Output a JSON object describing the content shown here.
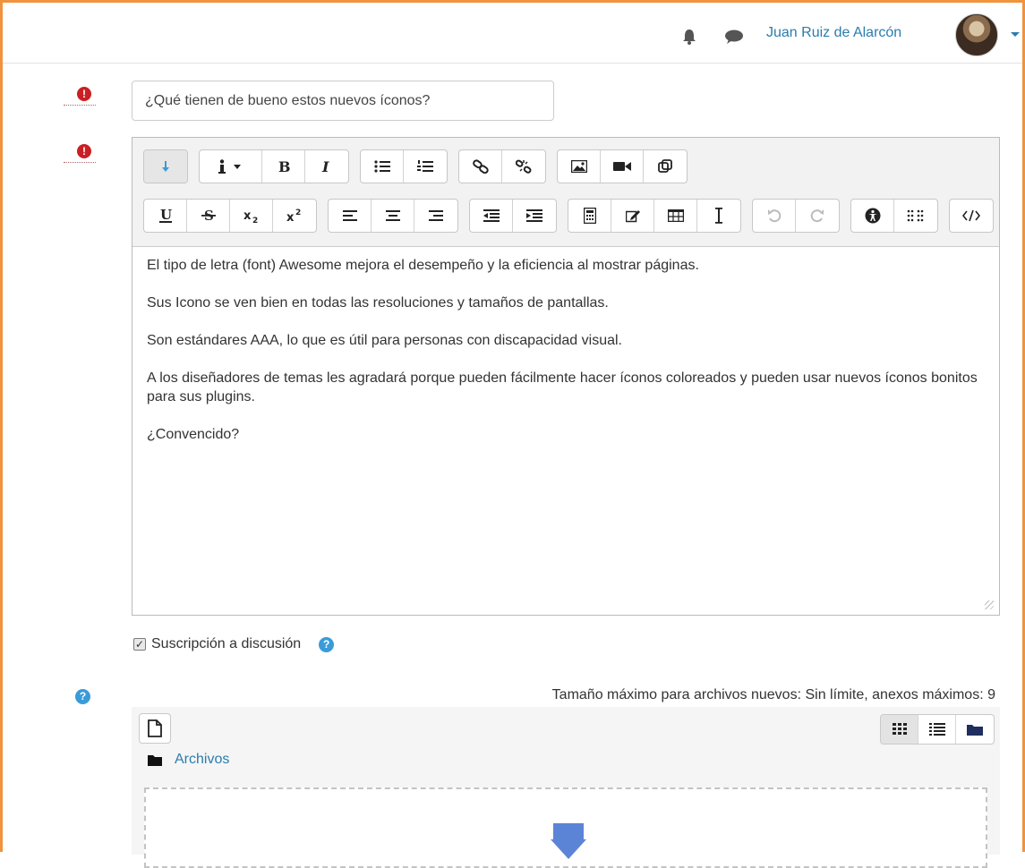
{
  "navbar": {
    "icons": [
      "bell-icon",
      "chat-icon"
    ],
    "user_name": "Juan Ruiz de Alarcón"
  },
  "form": {
    "subject_value": "¿Qué tienen de bueno estos nuevos íconos?",
    "required_icon": "exclamation-icon"
  },
  "editor": {
    "toolbar_row1": [
      "show-more-icon",
      "info-dropdown-icon",
      "bold-icon",
      "italic-icon",
      "unordered-list-icon",
      "ordered-list-icon",
      "link-icon",
      "unlink-icon",
      "image-icon",
      "video-icon",
      "media-icon"
    ],
    "toolbar_row2": [
      "underline-icon",
      "strikethrough-icon",
      "subscript-icon",
      "superscript-icon",
      "align-left-icon",
      "align-center-icon",
      "align-right-icon",
      "outdent-icon",
      "indent-icon",
      "calculator-icon",
      "edit-icon",
      "table-icon",
      "cursor-icon",
      "undo-icon",
      "redo-icon",
      "accessibility-icon",
      "screenreader-icon",
      "html-icon"
    ],
    "paragraphs": [
      "El tipo de letra (font) Awesome mejora el desempeño y la eficiencia al mostrar páginas.",
      "Sus Icono se ven bien en todas las resoluciones y tamaños de pantallas.",
      "Son estándares AAA, lo que es útil para personas con discapacidad visual.",
      "A los diseñadores de temas les agradará porque pueden fácilmente hacer íconos coloreados y pueden usar nuevos íconos bonitos para sus plugins.",
      "¿Convencido?"
    ]
  },
  "subscription": {
    "label": "Suscripción a discusión",
    "checked": true
  },
  "attachments": {
    "max_size_text": "Tamaño máximo para archivos nuevos: Sin límite, anexos máximos: 9",
    "folder_name": "Archivos",
    "view_modes": [
      "grid-icon",
      "list-icon",
      "folder-icon"
    ],
    "active_view": "grid-icon"
  },
  "colors": {
    "accent": "#2a7dad",
    "frame": "#f0933c",
    "required": "#ca1f23",
    "help": "#3a9bd9"
  }
}
